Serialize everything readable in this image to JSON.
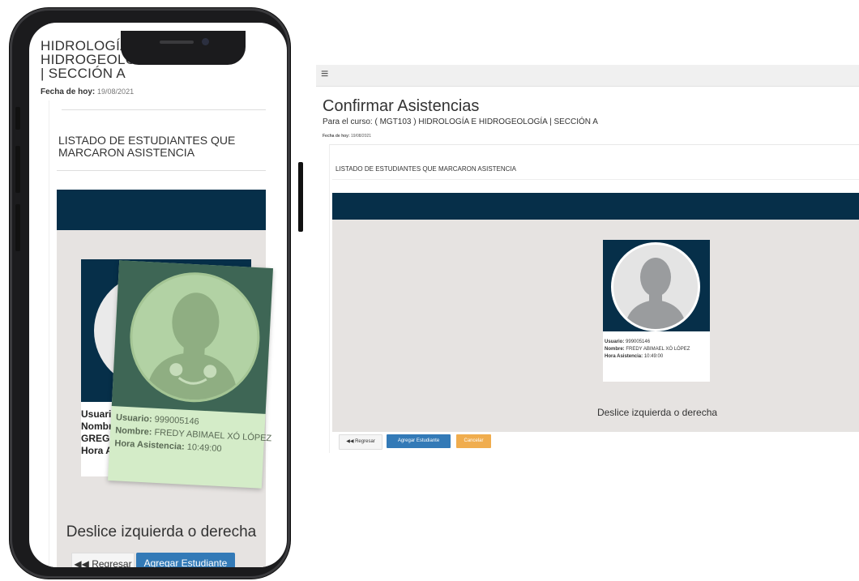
{
  "mobile": {
    "course_title": "HIDROLOGÍA E\nHIDROGEOLOGÍA\n| SECCIÓN A",
    "date_label": "Fecha de hoy:",
    "date_value": "19/08/2021",
    "listado": "LISTADO DE ESTUDIANTES QUE MARCARON ASISTENCIA",
    "back_card": {
      "usuario_label": "Usuari",
      "nombre_label": "Nombr",
      "extra": "GREG",
      "hora_label": "Hora A"
    },
    "front_card": {
      "usuario_label": "Usuario:",
      "usuario_value": "999005146",
      "nombre_label": "Nombre:",
      "nombre_value": "FREDY ABIMAEL XÓ LÓPEZ",
      "hora_label": "Hora Asistencia:",
      "hora_value": "10:49:00"
    },
    "deslice": "Deslice izquierda o derecha",
    "btn_back": "◀◀ Regresar",
    "btn_add": "Agregar Estudiante"
  },
  "desktop": {
    "menu_icon": "≡",
    "title": "Confirmar Asistencias",
    "subtitle": "Para el curso: ( MGT103 ) HIDROLOGÍA E HIDROGEOLOGÍA | SECCIÓN A",
    "date_label": "Fecha de hoy:",
    "date_value": "19/08/2021",
    "listado": "LISTADO DE ESTUDIANTES QUE MARCARON ASISTENCIA",
    "card": {
      "usuario_label": "Usuario:",
      "usuario_value": "999005146",
      "nombre_label": "Nombre:",
      "nombre_value": "FREDY ABIMAEL XÓ LÓPEZ",
      "hora_label": "Hora Asistencia:",
      "hora_value": "10:49:00"
    },
    "deslice": "Deslice izquierda o derecha",
    "btn_back": "◀◀ Regresar",
    "btn_add": "Agregar Estudiante",
    "btn_cancel": "Cancelar"
  },
  "colors": {
    "navy": "#062f49",
    "carousel_bg": "#e6e3e1",
    "primary": "#337ab7",
    "warning": "#f0ad4e",
    "swipe_card": "#d4ecc8"
  }
}
